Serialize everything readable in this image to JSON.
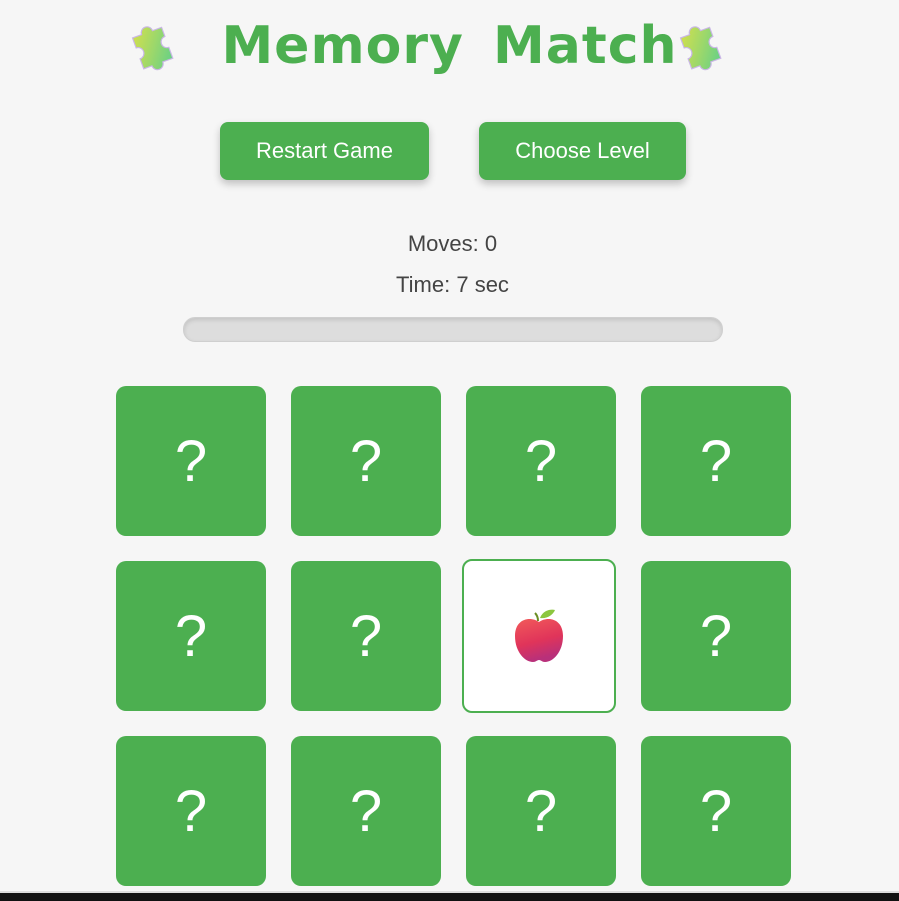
{
  "header": {
    "title": "Memory Match",
    "left_icon": "puzzle-piece-icon",
    "right_icon": "puzzle-piece-icon"
  },
  "controls": {
    "restart_label": "Restart Game",
    "level_label": "Choose Level"
  },
  "stats": {
    "moves_text": "Moves: 0",
    "time_text": "Time: 7 sec",
    "progress_fraction": 0
  },
  "board": {
    "hidden_symbol": "?",
    "cards": [
      {
        "state": "hidden"
      },
      {
        "state": "hidden"
      },
      {
        "state": "hidden"
      },
      {
        "state": "hidden"
      },
      {
        "state": "hidden"
      },
      {
        "state": "hidden"
      },
      {
        "state": "flipped",
        "icon": "apple-icon"
      },
      {
        "state": "hidden"
      },
      {
        "state": "hidden"
      },
      {
        "state": "hidden"
      },
      {
        "state": "hidden"
      },
      {
        "state": "hidden"
      }
    ]
  },
  "colors": {
    "accent": "#4caf50",
    "background": "#f6f6f6",
    "text": "#444444"
  }
}
